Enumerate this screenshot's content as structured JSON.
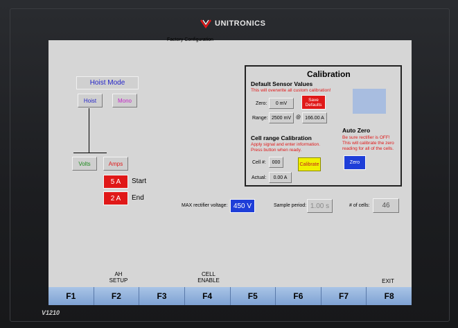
{
  "brand": "UNITRONICS",
  "model": "V1210",
  "screen": {
    "title": "Factory Configuration",
    "hoist": {
      "mode_label": "Hoist Mode",
      "hoist_btn": "Hoist",
      "mono_btn": "Mono",
      "volts_btn": "Volts",
      "amps_btn": "Amps",
      "start_value": "5 A",
      "start_label": "Start",
      "end_value": "2 A",
      "end_label": "End"
    },
    "calibration": {
      "title": "Calibration",
      "defaults_title": "Default Sensor Values",
      "defaults_warning": "This will overwrite all custom calibration!",
      "zero_label": "Zero:",
      "zero_value": "0 mV",
      "save_defaults": "Save Defaults",
      "range_label": "Range:",
      "range_value": "2500 mV",
      "at_symbol": "@",
      "range_amps": "166.00 A",
      "cell_title": "Cell range Calibration",
      "cell_instr1": "Apply signal and enter information.",
      "cell_instr2": "Press button when ready.",
      "cell_label": "Cell #:",
      "cell_value": "000",
      "calibrate_btn": "Calibrate",
      "actual_label": "Actual:",
      "actual_value": "0.00 A",
      "auto_zero_title": "Auto Zero",
      "auto_zero_warn1": "Be sure rectifier is OFF!",
      "auto_zero_warn2": "This will calibrate the zero",
      "auto_zero_warn3": "reading for all of the cells.",
      "zero_btn": "Zero"
    },
    "bottom": {
      "max_voltage_label": "MAX rectifier voltage:",
      "max_voltage_value": "450 V",
      "sample_label": "Sample period:",
      "sample_value": "1.00 s",
      "cells_label": "# of cells:",
      "cells_value": "46"
    },
    "fkey_captions": {
      "f2": [
        "AH",
        "SETUP"
      ],
      "f4": [
        "CELL",
        "ENABLE"
      ],
      "f8": [
        "EXIT"
      ]
    },
    "fkeys": [
      "F1",
      "F2",
      "F3",
      "F4",
      "F5",
      "F6",
      "F7",
      "F8"
    ]
  },
  "colors": {
    "red_button": "#e01818",
    "blue_field": "#1e3ed8",
    "yellow_button": "#f0f000",
    "empty_box": "#a8bde0"
  }
}
